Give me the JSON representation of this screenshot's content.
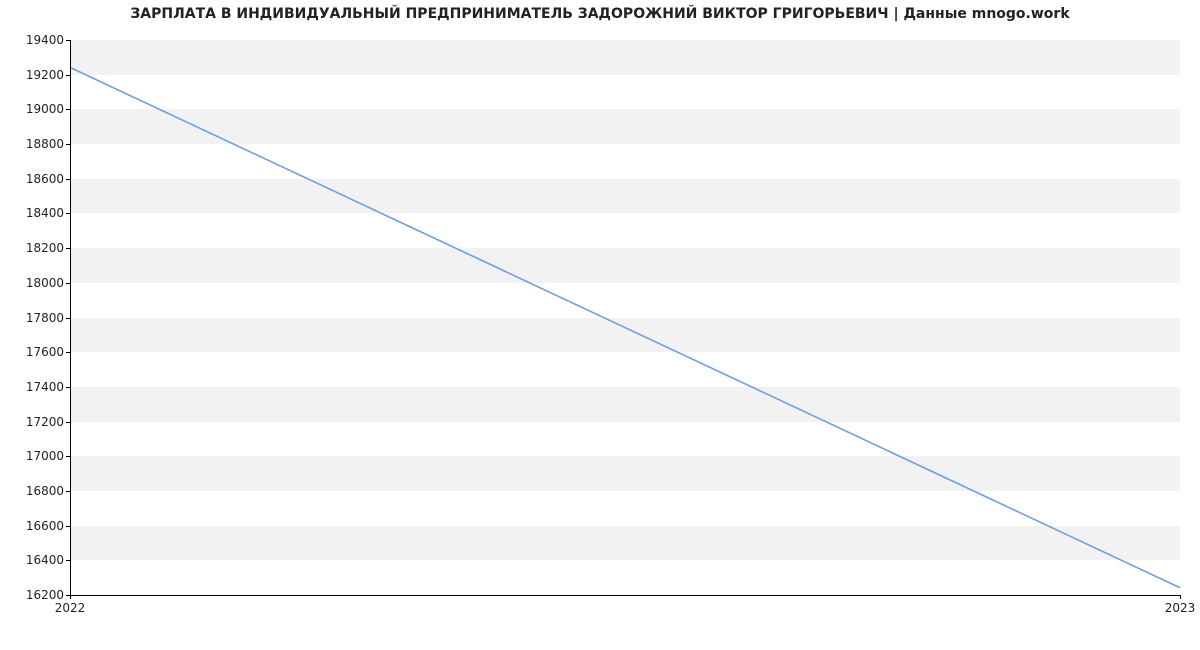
{
  "chart_data": {
    "type": "line",
    "title": "ЗАРПЛАТА В ИНДИВИДУАЛЬНЫЙ ПРЕДПРИНИМАТЕЛЬ ЗАДОРОЖНИЙ ВИКТОР ГРИГОРЬЕВИЧ | Данные mnogo.work",
    "x": [
      "2022",
      "2023"
    ],
    "values": [
      19242,
      16242
    ],
    "xlabel": "",
    "ylabel": "",
    "xlim": [
      "2022",
      "2023"
    ],
    "ylim": [
      16200,
      19400
    ],
    "y_ticks": [
      16200,
      16400,
      16600,
      16800,
      17000,
      17200,
      17400,
      17600,
      17800,
      18000,
      18200,
      18400,
      18600,
      18800,
      19000,
      19200,
      19400
    ],
    "x_ticks": [
      "2022",
      "2023"
    ],
    "line_color": "#6f9fe3",
    "grid": true
  }
}
